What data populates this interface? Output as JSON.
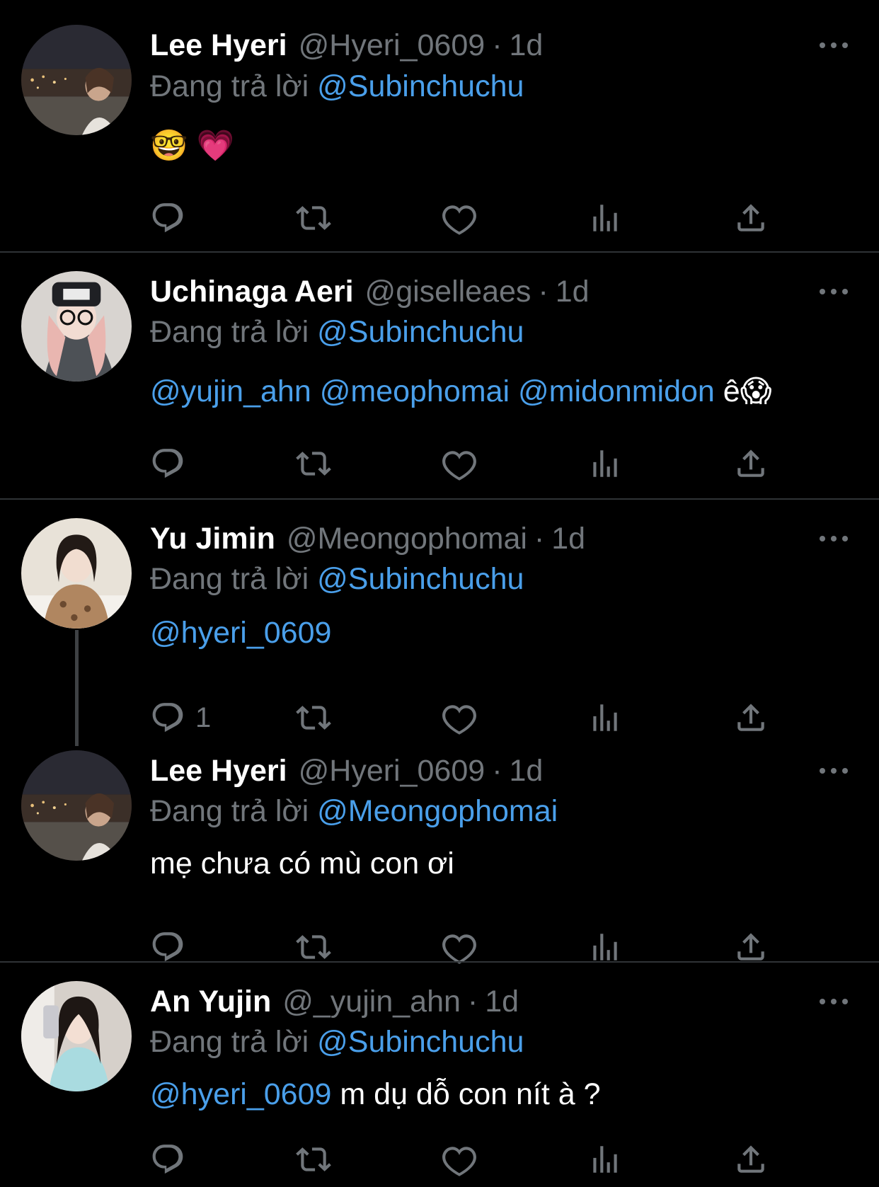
{
  "reply_prefix": "Đang trả lời",
  "tweets": [
    {
      "name": "Lee Hyeri",
      "handle": "@Hyeri_0609",
      "time": "1d",
      "reply_to": "@Subinchuchu",
      "body_emoji": "🤓 💗"
    },
    {
      "name": "Uchinaga Aeri",
      "handle": "@giselleaes",
      "time": "1d",
      "reply_to": "@Subinchuchu",
      "body_mentions": "@yujin_ahn @meophomai @midonmidon",
      "body_text": " ê😱"
    },
    {
      "name": "Yu Jimin",
      "handle": "@Meongophomai",
      "time": "1d",
      "reply_to": "@Subinchuchu",
      "body_mentions": "@hyeri_0609",
      "reply_count": "1"
    },
    {
      "name": "Lee Hyeri",
      "handle": "@Hyeri_0609",
      "time": "1d",
      "reply_to": "@Meongophomai",
      "body_text": "mẹ chưa có mù con ơi"
    },
    {
      "name": "An Yujin",
      "handle": "@_yujin_ahn",
      "time": "1d",
      "reply_to": "@Subinchuchu",
      "body_mentions": "@hyeri_0609",
      "body_text": " m dụ dỗ con nít à ?"
    }
  ],
  "colors": {
    "background": "#000000",
    "muted": "#71767b",
    "mention": "#4a9fea",
    "divider": "#2f3336"
  },
  "icons": [
    "reply-icon",
    "retweet-icon",
    "like-icon",
    "views-icon",
    "share-icon",
    "more-icon"
  ]
}
